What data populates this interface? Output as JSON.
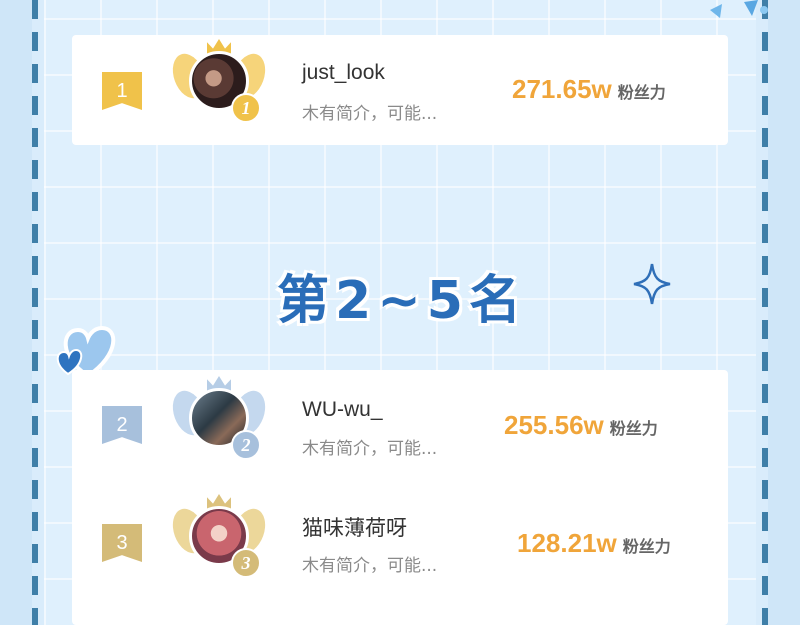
{
  "section_title": "第2~5名",
  "fans_label": "粉丝力",
  "colors": {
    "gold": "#f0c24a",
    "silver": "#a7c0dc",
    "bronze": "#d4bb78",
    "accent": "#f0a53a",
    "title": "#2a6db8"
  },
  "top": {
    "rank": "1",
    "medal": "1",
    "name": "just_look",
    "bio": "木有简介，可能...",
    "fans": "271.65w"
  },
  "list": [
    {
      "rank": "2",
      "medal": "2",
      "name": "WU-wu_",
      "bio": "木有简介，可能...",
      "fans": "255.56w"
    },
    {
      "rank": "3",
      "medal": "3",
      "name": "猫味薄荷呀",
      "bio": "木有简介，可能...",
      "fans": "128.21w"
    }
  ]
}
